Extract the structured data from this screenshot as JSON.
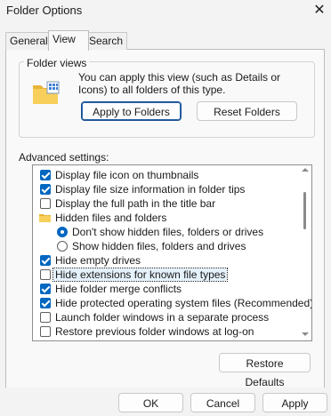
{
  "window": {
    "title": "Folder Options",
    "close_glyph": "✕"
  },
  "tabs": [
    {
      "label": "General",
      "active": false
    },
    {
      "label": "View",
      "active": true
    },
    {
      "label": "Search",
      "active": false
    }
  ],
  "folder_views": {
    "label": "Folder views",
    "description": "You can apply this view (such as Details or Icons) to all folders of this type.",
    "apply_button": "Apply to Folders",
    "reset_button": "Reset Folders"
  },
  "advanced": {
    "label": "Advanced settings:",
    "items": [
      {
        "type": "checkbox",
        "checked": true,
        "label": "Display file icon on thumbnails",
        "indent": 0
      },
      {
        "type": "checkbox",
        "checked": true,
        "label": "Display file size information in folder tips",
        "indent": 0
      },
      {
        "type": "checkbox",
        "checked": false,
        "label": "Display the full path in the title bar",
        "indent": 0
      },
      {
        "type": "folder",
        "label": "Hidden files and folders",
        "indent": 0
      },
      {
        "type": "radio",
        "checked": true,
        "label": "Don't show hidden files, folders or drives",
        "indent": 1
      },
      {
        "type": "radio",
        "checked": false,
        "label": "Show hidden files, folders and drives",
        "indent": 1
      },
      {
        "type": "checkbox",
        "checked": true,
        "label": "Hide empty drives",
        "indent": 0
      },
      {
        "type": "checkbox",
        "checked": false,
        "label": "Hide extensions for known file types",
        "indent": 0,
        "focused": true
      },
      {
        "type": "checkbox",
        "checked": true,
        "label": "Hide folder merge conflicts",
        "indent": 0
      },
      {
        "type": "checkbox",
        "checked": true,
        "label": "Hide protected operating system files (Recommended)",
        "indent": 0
      },
      {
        "type": "checkbox",
        "checked": false,
        "label": "Launch folder windows in a separate process",
        "indent": 0
      },
      {
        "type": "checkbox",
        "checked": false,
        "label": "Restore previous folder windows at log-on",
        "indent": 0
      }
    ],
    "restore_button": "Restore Defaults"
  },
  "footer": {
    "ok": "OK",
    "cancel": "Cancel",
    "apply": "Apply"
  },
  "colors": {
    "accent": "#0067c0",
    "background": "#f3f3f3",
    "panel": "#f9f9f9"
  }
}
